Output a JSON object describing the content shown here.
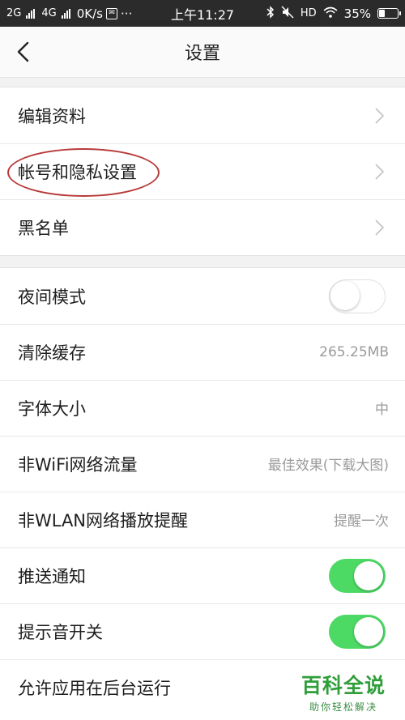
{
  "status_bar": {
    "sim1": "2G",
    "sim2": "4G",
    "speed": "0K/s",
    "time": "上午11:27",
    "hd": "HD",
    "battery": "35%",
    "battery_level": 0.35,
    "more": "···"
  },
  "nav": {
    "title": "设置",
    "back_icon": "chevron-left-icon"
  },
  "account_group": [
    {
      "label": "编辑资料"
    },
    {
      "label": "帐号和隐私设置"
    },
    {
      "label": "黑名单"
    }
  ],
  "settings": {
    "night_mode": {
      "label": "夜间模式",
      "on": false
    },
    "clear_cache": {
      "label": "清除缓存",
      "value": "265.25MB"
    },
    "font_size": {
      "label": "字体大小",
      "value": "中"
    },
    "non_wifi_traffic": {
      "label": "非WiFi网络流量",
      "value": "最佳效果(下载大图)"
    },
    "non_wlan_reminder": {
      "label": "非WLAN网络播放提醒",
      "value": "提醒一次"
    },
    "push_notify": {
      "label": "推送通知",
      "on": true
    },
    "sound_switch": {
      "label": "提示音开关",
      "on": true
    },
    "background_run": {
      "label": "允许应用在后台运行"
    }
  },
  "colors": {
    "toggle_on": "#4cd964",
    "annotation": "#b83a3a",
    "watermark": "#2f9e3a"
  },
  "watermark": {
    "main": "百科全说",
    "sub": "助你轻松解决"
  }
}
